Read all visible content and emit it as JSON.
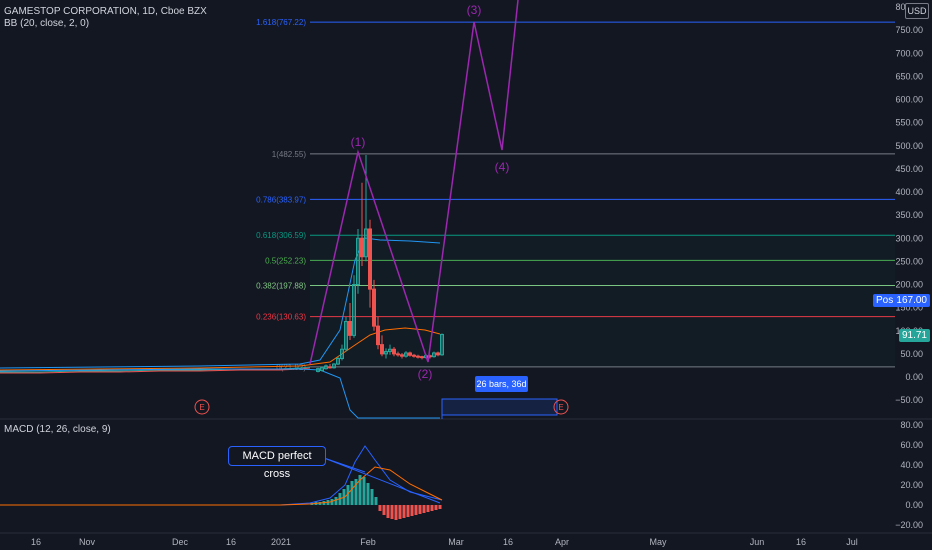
{
  "legend": {
    "symbol": "GAMESTOP CORPORATION, 1D, Cboe BZX",
    "bb": "BB (20, close, 2, 0)",
    "macd": "MACD (12, 26, close, 9)"
  },
  "currency_button": "USD",
  "price_axis": {
    "labels": [
      "800.00",
      "750.00",
      "700.00",
      "650.00",
      "600.00",
      "550.00",
      "500.00",
      "450.00",
      "400.00",
      "350.00",
      "300.00",
      "250.00",
      "200.00",
      "150.00",
      "100.00",
      "50.00",
      "0.00",
      "−50.00"
    ],
    "values": [
      800,
      750,
      700,
      650,
      600,
      550,
      500,
      450,
      400,
      350,
      300,
      250,
      200,
      150,
      100,
      50,
      0,
      -50
    ]
  },
  "macd_axis": {
    "labels": [
      "80.00",
      "60.00",
      "40.00",
      "20.00",
      "0.00",
      "−20.00"
    ],
    "values": [
      80,
      60,
      40,
      20,
      0,
      -20
    ]
  },
  "time_axis": [
    "16",
    "Nov",
    "Dec",
    "16",
    "2021",
    "Feb",
    "Mar",
    "16",
    "Apr",
    "May",
    "Jun",
    "16",
    "Jul"
  ],
  "price_tags": {
    "post_label": "Post",
    "post_value": "167.00",
    "last_value": "91.71"
  },
  "fib_levels": [
    {
      "label": "1.618(767.22)",
      "value": 767.22,
      "color": "#2962ff"
    },
    {
      "label": "1(482.55)",
      "value": 482.55,
      "color": "#787b86"
    },
    {
      "label": "0.786(383.97)",
      "value": 383.97,
      "color": "#2962ff"
    },
    {
      "label": "0.618(306.59)",
      "value": 306.59,
      "color": "#089981"
    },
    {
      "label": "0.5(252.23)",
      "value": 252.23,
      "color": "#4caf50"
    },
    {
      "label": "0.382(197.88)",
      "value": 197.88,
      "color": "#81c784"
    },
    {
      "label": "0.236(130.63)",
      "value": 130.63,
      "color": "#f23645"
    },
    {
      "label": "0(21.92)",
      "value": 21.92,
      "color": "#787b86"
    }
  ],
  "waves": [
    "(1)",
    "(2)",
    "(3)",
    "(4)"
  ],
  "event_marker": "E",
  "bars_range": "26 bars, 36d",
  "macd_annotation": "MACD perfect cross",
  "colors": {
    "background": "#131722",
    "up": "#26a69a",
    "down": "#ef5350",
    "wave": "#9c27b0",
    "accent": "#2962ff"
  }
}
